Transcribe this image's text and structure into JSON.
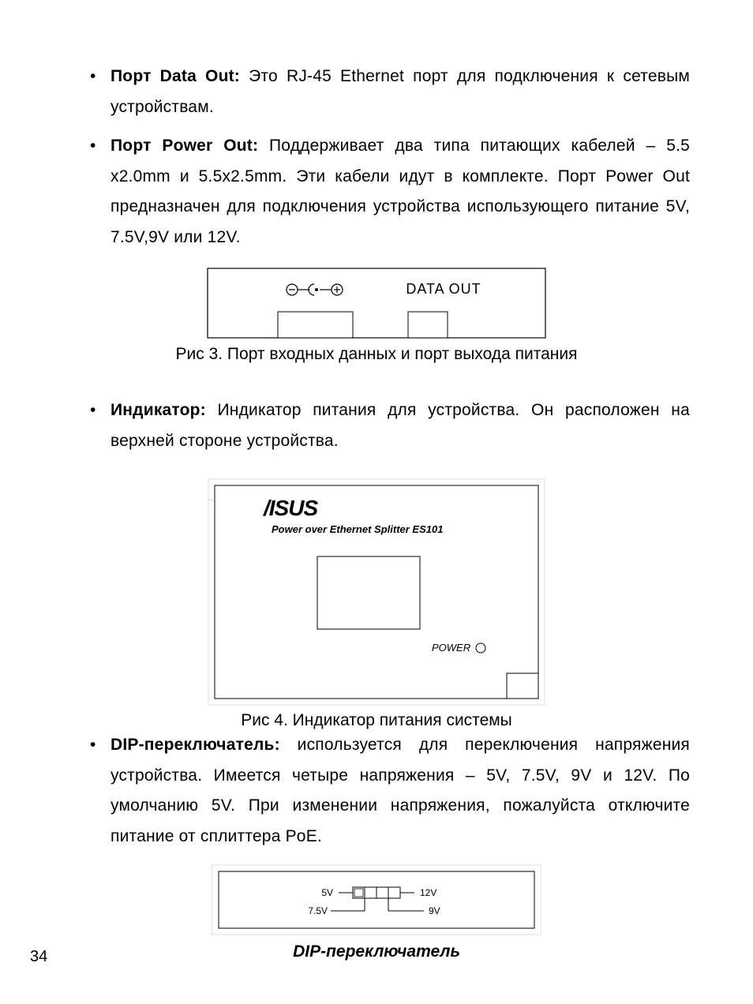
{
  "bullets": {
    "b1_term": "Порт Data Out:",
    "b1_text": " Это RJ-45 Ethernet порт для подключения к сетевым устройствам.",
    "b2_term": "Порт Power Out:",
    "b2_text": " Поддерживает два типа питающих кабелей – 5.5 x2.0mm и 5.5x2.5mm. Эти кабели идут в комплекте. Порт Power Out предназначен для подключения устройства использующего питание 5V, 7.5V,9V или 12V.",
    "b3_term": "Индикатор:",
    "b3_text": " Индикатор питания для устройства. Он расположен на верхней стороне устройства.",
    "b4_term": "DIP-переключатель:",
    "b4_text": " используется для переключения напряжения устройства. Имеется четыре напряжения – 5V, 7.5V, 9V и 12V. По умолчанию 5V. При изменении напряжения, пожалуйста отключите питание от сплиттера PoE."
  },
  "figures": {
    "fig3": {
      "label_data_out": "DATA OUT",
      "caption": "Рис 3. Порт входных данных и порт выхода питания"
    },
    "fig4": {
      "brand": "ASUS",
      "subtitle": "Power over Ethernet Splitter ES101",
      "power_label": "POWER",
      "caption": "Рис 4. Индикатор питания системы"
    },
    "fig5": {
      "v5": "5V",
      "v75": "7.5V",
      "v12": "12V",
      "v9": "9V",
      "caption": "DIP-переключатель"
    }
  },
  "page_number": "34"
}
